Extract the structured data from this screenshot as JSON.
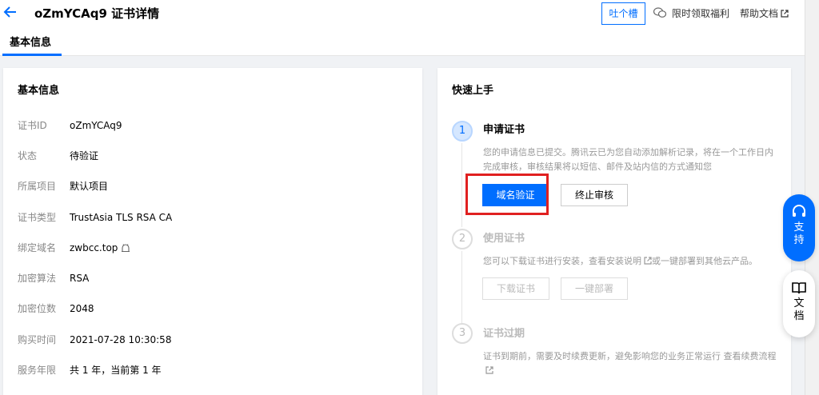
{
  "header": {
    "title": "oZmYCAq9 证书详情",
    "feedback_label": "吐个槽",
    "benefit_label": "限时领取福利",
    "help_label": "帮助文档"
  },
  "tabs": [
    {
      "label": "基本信息"
    }
  ],
  "basic_info": {
    "title": "基本信息",
    "rows": [
      {
        "label": "证书ID",
        "value": "oZmYCAq9"
      },
      {
        "label": "状态",
        "value": "待验证"
      },
      {
        "label": "所属项目",
        "value": "默认项目"
      },
      {
        "label": "证书类型",
        "value": "TrustAsia TLS RSA CA"
      },
      {
        "label": "绑定域名",
        "value": "zwbcc.top"
      },
      {
        "label": "加密算法",
        "value": "RSA"
      },
      {
        "label": "加密位数",
        "value": "2048"
      },
      {
        "label": "购买时间",
        "value": "2021-07-28 10:30:58"
      },
      {
        "label": "服务年限",
        "value": "共 1 年，当前第 1 年"
      }
    ]
  },
  "quick_start": {
    "title": "快速上手",
    "steps": [
      {
        "number": "1",
        "title": "申请证书",
        "desc": "您的申请信息已提交。腾讯云已为您自动添加解析记录，将在一个工作日内完成审核，审核结果将以短信、邮件及站内信的方式通知您",
        "primary_button": "域名验证",
        "secondary_button": "终止审核"
      },
      {
        "number": "2",
        "title": "使用证书",
        "desc_before_link": "您可以下载证书进行安装，查看安装说明",
        "desc_after_link": "或一键部署到其他云产品。",
        "button_1": "下载证书",
        "button_2": "一键部署"
      },
      {
        "number": "3",
        "title": "证书过期",
        "desc": "证书到期前，需要及时续费更新，避免影响您的业务正常运行 查看续费流程"
      }
    ]
  },
  "float": {
    "support_label": "支持",
    "docs_label": "文档"
  },
  "colors": {
    "accent": "#006eff",
    "highlight": "#e02020"
  }
}
